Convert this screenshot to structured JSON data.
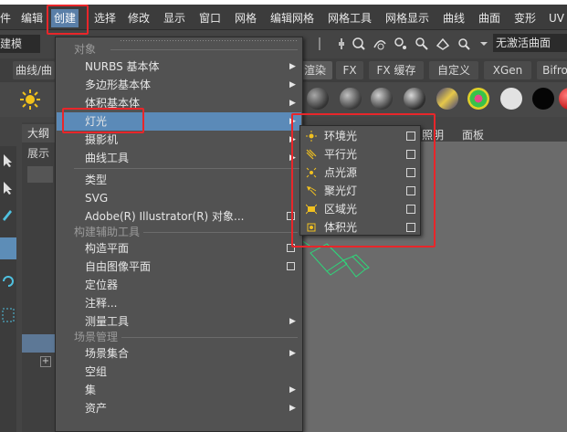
{
  "menubar": {
    "items": [
      "件",
      "编辑",
      "创建",
      "选择",
      "修改",
      "显示",
      "窗口",
      "网格",
      "编辑网格",
      "网格工具",
      "网格显示",
      "曲线",
      "曲面",
      "变形",
      "UV"
    ]
  },
  "shelfrow": {
    "mode_field": "建模",
    "no_active_surface": "无激活曲面"
  },
  "tabs": [
    "曲线/曲",
    "渲染",
    "FX",
    "FX 缓存",
    "自定义",
    "XGen",
    "Bifro"
  ],
  "outliner": {
    "tab_label": "大纲",
    "display_label": "展示"
  },
  "viewport": {
    "menu_lighting": "照明",
    "menu_panels": "面板"
  },
  "create_menu": {
    "section_objects": "对象",
    "items_objects": [
      {
        "label": "NURBS 基本体",
        "submenu": true
      },
      {
        "label": "多边形基本体",
        "submenu": true
      },
      {
        "label": "体积基本体",
        "submenu": true
      },
      {
        "label": "灯光",
        "submenu": true,
        "highlighted": true
      },
      {
        "label": "摄影机",
        "submenu": true
      },
      {
        "label": "曲线工具",
        "submenu": true
      }
    ],
    "items_text": [
      {
        "label": "类型"
      },
      {
        "label": "SVG"
      },
      {
        "label": "Adobe(R) Illustrator(R) 对象...",
        "option_box": true
      }
    ],
    "section_construction": "构建辅助工具",
    "items_construction": [
      {
        "label": "构造平面",
        "option_box": true
      },
      {
        "label": "自由图像平面",
        "option_box": true
      },
      {
        "label": "定位器"
      },
      {
        "label": "注释..."
      },
      {
        "label": "测量工具",
        "submenu": true
      }
    ],
    "section_scene": "场景管理",
    "items_scene": [
      {
        "label": "场景集合",
        "submenu": true
      },
      {
        "label": "空组"
      },
      {
        "label": "集",
        "submenu": true
      },
      {
        "label": "资产",
        "submenu": true
      }
    ]
  },
  "lights_menu": {
    "items": [
      {
        "label": "环境光",
        "icon": "ambient-light-icon"
      },
      {
        "label": "平行光",
        "icon": "directional-light-icon"
      },
      {
        "label": "点光源",
        "icon": "point-light-icon"
      },
      {
        "label": "聚光灯",
        "icon": "spot-light-icon"
      },
      {
        "label": "区域光",
        "icon": "area-light-icon"
      },
      {
        "label": "体积光",
        "icon": "volume-light-icon"
      }
    ]
  },
  "colors": {
    "highlight_blue": "#5b8ab8",
    "annotation_red": "#e8262a",
    "menu_bg": "#525252"
  }
}
